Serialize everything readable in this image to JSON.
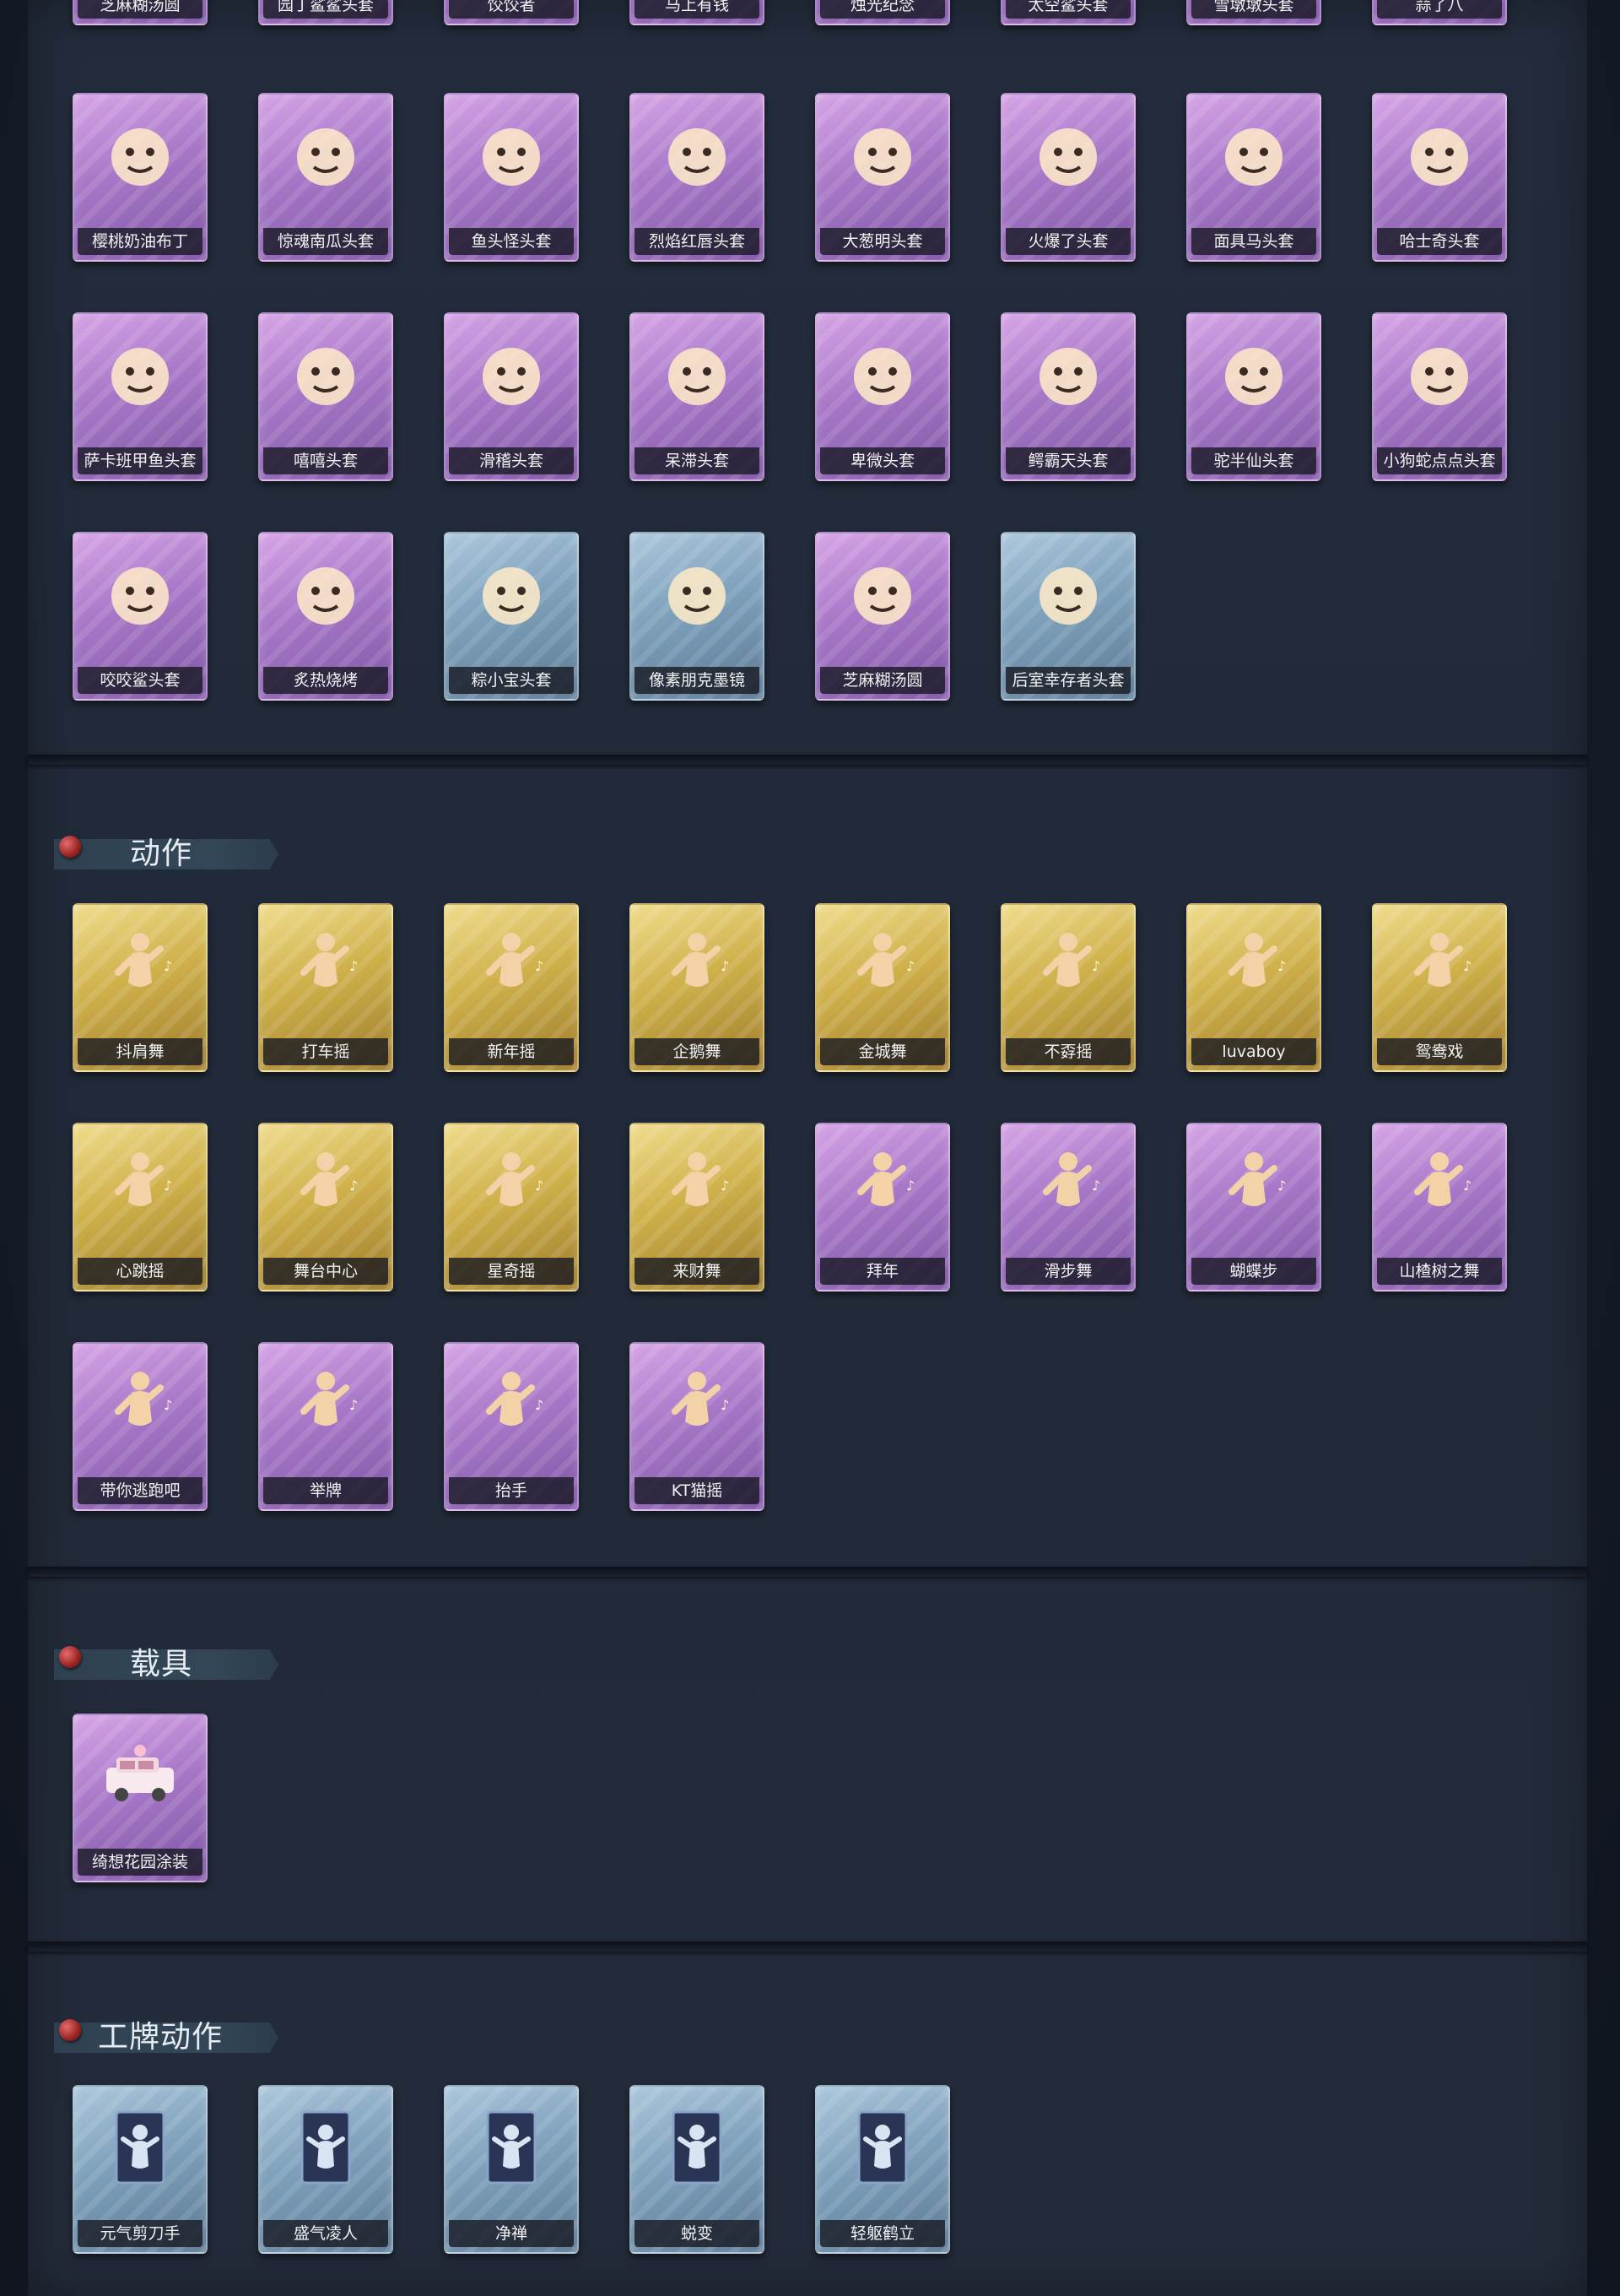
{
  "sections": {
    "headwear": {
      "rows": [
        [
          "芝麻糊汤圆",
          "园丁鲨鲨头套",
          "饺饺者",
          "马上有钱",
          "烛光纪念",
          "太空鲨头套",
          "雪墩墩头套",
          "蒜了八"
        ],
        [
          "樱桃奶油布丁",
          "惊魂南瓜头套",
          "鱼头怪头套",
          "烈焰红唇头套",
          "大葱明头套",
          "火爆了头套",
          "面具马头套",
          "哈士奇头套"
        ],
        [
          "萨卡班甲鱼头套",
          "嘻嘻头套",
          "滑稽头套",
          "呆滞头套",
          "卑微头套",
          "鳄霸天头套",
          "驼半仙头套",
          "小狗蛇点点头套"
        ],
        [
          "咬咬鲨头套",
          "炙热烧烤",
          "粽小宝头套",
          "像素朋克墨镜",
          "芝麻糊汤圆",
          "后室幸存者头套"
        ]
      ],
      "row_colors": [
        [
          "purple",
          "purple",
          "purple",
          "purple",
          "purple",
          "purple",
          "purple",
          "purple"
        ],
        [
          "purple",
          "purple",
          "purple",
          "purple",
          "purple",
          "purple",
          "purple",
          "purple"
        ],
        [
          "purple",
          "purple",
          "purple",
          "purple",
          "purple",
          "purple",
          "purple",
          "purple"
        ],
        [
          "purple",
          "purple",
          "blue",
          "blue",
          "purple",
          "blue"
        ]
      ]
    },
    "actions": {
      "title": "动作",
      "rows": [
        [
          "抖肩舞",
          "打车摇",
          "新年摇",
          "企鹅舞",
          "金城舞",
          "不孬摇",
          "luvaboy",
          "鸳鸯戏"
        ],
        [
          "心跳摇",
          "舞台中心",
          "星奇摇",
          "来财舞",
          "拜年",
          "滑步舞",
          "蝴蝶步",
          "山楂树之舞"
        ],
        [
          "带你逃跑吧",
          "举牌",
          "抬手",
          "KT猫摇"
        ]
      ],
      "row_colors": [
        [
          "gold",
          "gold",
          "gold",
          "gold",
          "gold",
          "gold",
          "gold",
          "gold"
        ],
        [
          "gold",
          "gold",
          "gold",
          "gold",
          "purple",
          "purple",
          "purple",
          "purple"
        ],
        [
          "purple",
          "purple",
          "purple",
          "purple"
        ]
      ]
    },
    "vehicles": {
      "title": "载具",
      "rows": [
        [
          "绮想花园涂装"
        ]
      ],
      "row_colors": [
        [
          "purple"
        ]
      ]
    },
    "badge_actions": {
      "title": "工牌动作",
      "rows": [
        [
          "元气剪刀手",
          "盛气凌人",
          "净禅",
          "蜕变",
          "轻躯鹤立"
        ]
      ],
      "row_colors": [
        [
          "blue",
          "blue",
          "blue",
          "blue",
          "blue"
        ]
      ]
    }
  },
  "colors": {
    "purple_card": "#a777c7",
    "gold_card": "#cfb04a",
    "blue_card": "#7ea0bb",
    "panel_bg": "#232c3c",
    "label_bg": "#1a1c28"
  }
}
